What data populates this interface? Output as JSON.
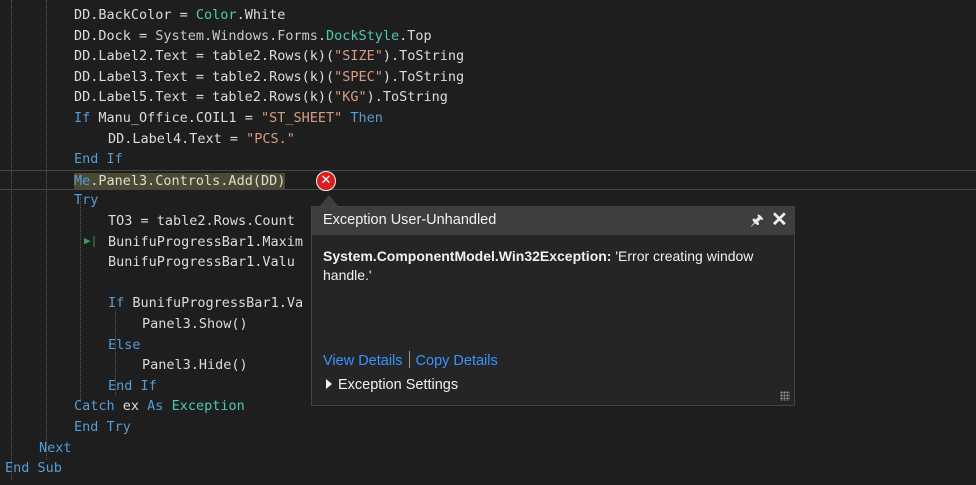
{
  "colors": {
    "keyword": "#569cd6",
    "string": "#d69d85",
    "type": "#4ec9b0",
    "namespace": "#c8c8c8",
    "default": "#dcdcdc",
    "highlight": "#4a4a33"
  },
  "code_lines": [
    {
      "tokens": [
        {
          "t": "DD.BackColor = ",
          "c": "default"
        },
        {
          "t": "Color",
          "c": "type"
        },
        {
          "t": ".White",
          "c": "default"
        }
      ]
    },
    {
      "tokens": [
        {
          "t": "DD.Dock = ",
          "c": "default"
        },
        {
          "t": "System.Windows.Forms.",
          "c": "namespace"
        },
        {
          "t": "DockStyle",
          "c": "type"
        },
        {
          "t": ".Top",
          "c": "default"
        }
      ]
    },
    {
      "tokens": [
        {
          "t": "DD.Label2.Text = table2.Rows(k)(",
          "c": "default"
        },
        {
          "t": "\"SIZE\"",
          "c": "string"
        },
        {
          "t": ").ToString",
          "c": "default"
        }
      ]
    },
    {
      "tokens": [
        {
          "t": "DD.Label3.Text = table2.Rows(k)(",
          "c": "default"
        },
        {
          "t": "\"SPEC\"",
          "c": "string"
        },
        {
          "t": ").ToString",
          "c": "default"
        }
      ]
    },
    {
      "tokens": [
        {
          "t": "DD.Label5.Text = table2.Rows(k)(",
          "c": "default"
        },
        {
          "t": "\"KG\"",
          "c": "string"
        },
        {
          "t": ").ToString",
          "c": "default"
        }
      ]
    },
    {
      "tokens": [
        {
          "t": "If",
          "c": "keyword"
        },
        {
          "t": " Manu_Office.COIL1 = ",
          "c": "default"
        },
        {
          "t": "\"ST_SHEET\"",
          "c": "string"
        },
        {
          "t": " ",
          "c": "default"
        },
        {
          "t": "Then",
          "c": "keyword"
        }
      ]
    },
    {
      "tokens": [
        {
          "t": "DD.Label4.Text = ",
          "c": "default"
        },
        {
          "t": "\"PCS.\"",
          "c": "string"
        }
      ]
    },
    {
      "tokens": [
        {
          "t": "End If",
          "c": "keyword"
        }
      ]
    },
    {
      "current": true,
      "tokens": [
        {
          "t": "Me",
          "c": "keyword",
          "hl": true
        },
        {
          "t": ".Panel3.Controls.Add(DD)",
          "c": "default",
          "hl": true
        }
      ]
    },
    {
      "tokens": [
        {
          "t": "Try",
          "c": "keyword"
        }
      ]
    },
    {
      "tokens": [
        {
          "t": "TO3 = table2.Rows.Count",
          "c": "default"
        }
      ]
    },
    {
      "tokens": [
        {
          "t": "BunifuProgressBar1.Maxim",
          "c": "default"
        }
      ]
    },
    {
      "tokens": [
        {
          "t": "BunifuProgressBar1.Valu",
          "c": "default"
        }
      ]
    },
    {
      "tokens": []
    },
    {
      "tokens": [
        {
          "t": "If",
          "c": "keyword"
        },
        {
          "t": " BunifuProgressBar1.Va",
          "c": "default"
        }
      ]
    },
    {
      "tokens": [
        {
          "t": "Panel3.Show()",
          "c": "default"
        }
      ]
    },
    {
      "tokens": [
        {
          "t": "Else",
          "c": "keyword"
        }
      ]
    },
    {
      "tokens": [
        {
          "t": "Panel3.Hide()",
          "c": "default"
        }
      ]
    },
    {
      "tokens": [
        {
          "t": "End If",
          "c": "keyword"
        }
      ]
    },
    {
      "tokens": [
        {
          "t": "Catch",
          "c": "keyword"
        },
        {
          "t": " ex ",
          "c": "default"
        },
        {
          "t": "As",
          "c": "keyword"
        },
        {
          "t": " ",
          "c": "default"
        },
        {
          "t": "Exception",
          "c": "type"
        }
      ]
    },
    {
      "tokens": [
        {
          "t": "End Try",
          "c": "keyword"
        }
      ]
    },
    {
      "tokens": [
        {
          "t": "Next",
          "c": "keyword"
        }
      ]
    },
    {
      "tokens": [
        {
          "t": "End Sub",
          "c": "keyword"
        }
      ]
    }
  ],
  "popup": {
    "title": "Exception User-Unhandled",
    "pin_icon": "pin-icon",
    "close_icon": "close-icon",
    "exception_type": "System.ComponentModel.Win32Exception:",
    "exception_message": " 'Error creating window handle.'",
    "view_details": "View Details",
    "copy_details": "Copy Details",
    "exception_settings": "Exception Settings"
  },
  "error_glyph_icon": "error-circle-icon"
}
